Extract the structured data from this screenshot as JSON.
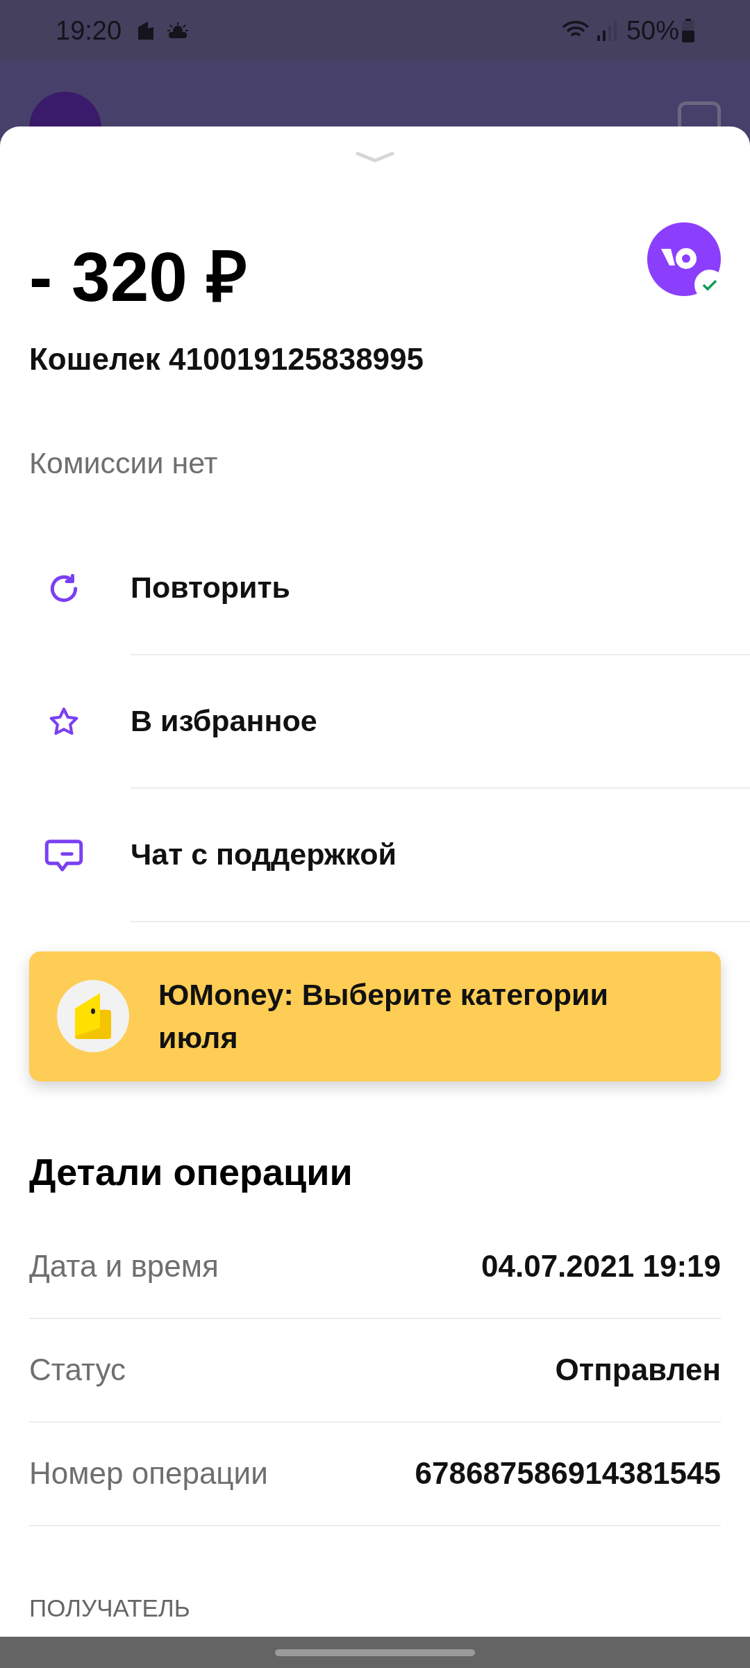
{
  "status_bar": {
    "time": "19:20",
    "battery": "50%"
  },
  "amount": "- 320 ₽",
  "account": "Кошелек 410019125838995",
  "fee": "Комиссии нет",
  "actions": [
    {
      "kind": "repeat",
      "label": "Повторить"
    },
    {
      "kind": "favorite",
      "label": "В избранное"
    },
    {
      "kind": "chat",
      "label": "Чат с поддержкой"
    }
  ],
  "banner": {
    "text": "ЮMoney: Выберите категории июля"
  },
  "details": {
    "title": "Детали операции",
    "rows": [
      {
        "label": "Дата и время",
        "value": "04.07.2021 19:19"
      },
      {
        "label": "Статус",
        "value": "Отправлен"
      },
      {
        "label": "Номер операции",
        "value": "678687586914381545"
      }
    ]
  },
  "recipient_heading": "ПОЛУЧАТЕЛЬ"
}
